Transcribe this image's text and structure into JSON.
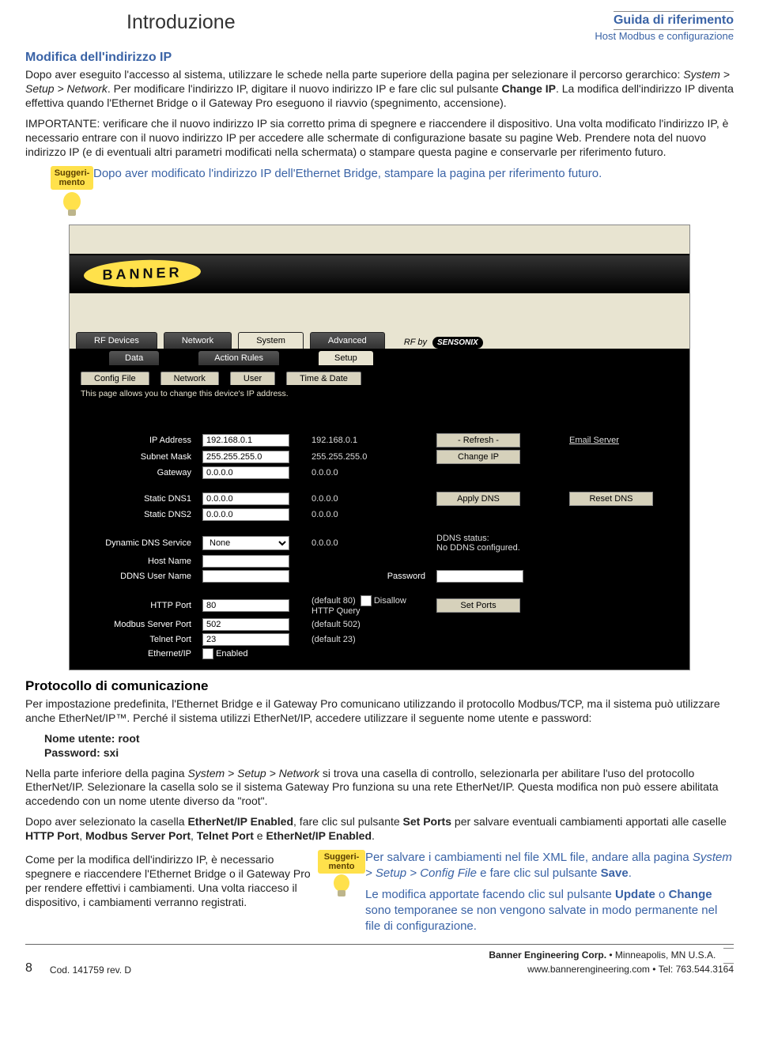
{
  "header": {
    "intro": "Introduzione",
    "guide": "Guida di riferimento",
    "subtitle": "Host Modbus e configurazione"
  },
  "section1": {
    "title": "Modifica dell'indirizzo IP",
    "p1a": "Dopo aver eseguito l'accesso al sistema, utilizzare le schede nella parte superiore della pagina per selezionare il percorso gerarchico: ",
    "p1b_em": "System > Setup > Network",
    "p1c": ". Per modificare l'indirizzo IP, digitare il nuovo indirizzo IP e fare clic sul pulsante ",
    "p1d_b": "Change IP",
    "p1e": ". La modifica dell'indirizzo IP diventa effettiva quando l'Ethernet Bridge o il Gateway Pro eseguono il riavvio (spegnimento, accensione).",
    "p2": "IMPORTANTE: verificare che il nuovo indirizzo IP sia corretto prima di spegnere e riaccendere il dispositivo. Una volta modificato l'indirizzo IP, è necessario entrare con il nuovo indirizzo IP per accedere alle schermate di configurazione basate su pagine Web. Prendere nota del nuovo indirizzo IP (e di eventuali altri parametri modificati nella schermata) o stampare questa pagine e conservarle per riferimento futuro."
  },
  "tip1": {
    "label": "Suggeri-mento",
    "text": "Dopo aver modificato l'indirizzo IP dell'Ethernet Bridge, stampare la pagina per riferimento futuro."
  },
  "ui": {
    "banner": "BANNER",
    "maintabs": [
      "RF Devices",
      "Network",
      "System",
      "Advanced"
    ],
    "maintab_active": 2,
    "rf_by": "RF by",
    "sensonix": "SENSONIX",
    "subtabs": [
      "Data",
      "Action Rules",
      "Setup"
    ],
    "subtab_active": 2,
    "subtabs2": [
      "Config File",
      "Network",
      "User",
      "Time & Date"
    ],
    "help": "This page allows you to change this device's IP address.",
    "rows": {
      "ip_label": "IP Address",
      "ip_val": "192.168.0.1",
      "ip_disp": "192.168.0.1",
      "mask_label": "Subnet Mask",
      "mask_val": "255.255.255.0",
      "mask_disp": "255.255.255.0",
      "gw_label": "Gateway",
      "gw_val": "0.0.0.0",
      "gw_disp": "0.0.0.0",
      "dns1_label": "Static DNS1",
      "dns1_val": "0.0.0.0",
      "dns1_disp": "0.0.0.0",
      "dns2_label": "Static DNS2",
      "dns2_val": "0.0.0.0",
      "dns2_disp": "0.0.0.0",
      "ddns_label": "Dynamic DNS Service",
      "ddns_val": "None",
      "ddns_disp": "0.0.0.0",
      "host_label": "Host Name",
      "ddnsu_label": "DDNS User Name",
      "pwd_label": "Password",
      "http_label": "HTTP Port",
      "http_val": "80",
      "http_def": "(default 80)",
      "disallow": "Disallow HTTP Query",
      "modbus_label": "Modbus Server Port",
      "modbus_val": "502",
      "modbus_def": "(default 502)",
      "telnet_label": "Telnet Port",
      "telnet_val": "23",
      "telnet_def": "(default 23)",
      "eip_label": "Ethernet/IP",
      "eip_chk": "Enabled"
    },
    "btns": {
      "refresh": "- Refresh -",
      "changeip": "Change IP",
      "applydns": "Apply DNS",
      "resetdns": "Reset DNS",
      "setports": "Set Ports",
      "emailserver": "Email Server",
      "ddns_status": "DDNS status:",
      "ddns_none": "No DDNS configured."
    }
  },
  "section2": {
    "title": "Protocollo di comunicazione",
    "p1": "Per impostazione predefinita, l'Ethernet Bridge e il Gateway Pro comunicano utilizzando il protocollo Modbus/TCP, ma il sistema può utilizzare anche EtherNet/IP™. Perché il sistema utilizzi EtherNet/IP, accedere utilizzare il seguente nome utente e password:",
    "user": "Nome utente: root",
    "pwd": "Password: sxi",
    "p2a": "Nella parte inferiore della pagina ",
    "p2b_em": "System > Setup > Network",
    "p2c": " si trova una casella di controllo, selezionarla per abilitare l'uso del protocollo EtherNet/IP. Selezionare la casella solo se il sistema Gateway Pro funziona su una rete EtherNet/IP. Questa modifica non può essere abilitata accedendo con un nome utente diverso da \"root\".",
    "p3a": "Dopo aver selezionato la casella ",
    "p3b": "EtherNet/IP Enabled",
    "p3c": ", fare clic sul pulsante ",
    "p3d": "Set Ports",
    "p3e": " per salvare eventuali cambiamenti apportati alle caselle ",
    "p3f": "HTTP Port",
    "p3g": ", ",
    "p3h": "Modbus Server Port",
    "p3i": ", ",
    "p3j": "Telnet Port",
    "p3k": " e ",
    "p3l": "EtherNet/IP Enabled",
    "p3m": ".",
    "p4": "Come per la modifica dell'indirizzo IP, è necessario spegnere e riaccendere l'Ethernet Bridge o il Gateway Pro per rendere effettivi i cambiamenti. Una volta riacceso il dispositivo, i cambiamenti verranno registrati."
  },
  "tip2": {
    "label": "Suggeri-mento",
    "line1a": "Per salvare i cambiamenti nel file XML file, andare alla pagina ",
    "line1b_em": "System > Setup > Config File",
    "line1c": " e fare clic sul pulsante ",
    "line1d_b": "Save",
    "line1e": ".",
    "line2a": "Le modifica apportate facendo clic sul pulsante ",
    "line2b_b": "Update",
    "line2c": " o ",
    "line2d_b": "Change",
    "line2e": " sono temporanee se non vengono salvate in modo permanente nel file di configurazione."
  },
  "footer": {
    "page": "8",
    "cod": "Cod. 141759 rev. D",
    "corp": "Banner Engineering Corp.",
    "loc": " • Minneapolis, MN U.S.A.",
    "web": "www.bannerengineering.com  •  Tel: 763.544.3164"
  }
}
